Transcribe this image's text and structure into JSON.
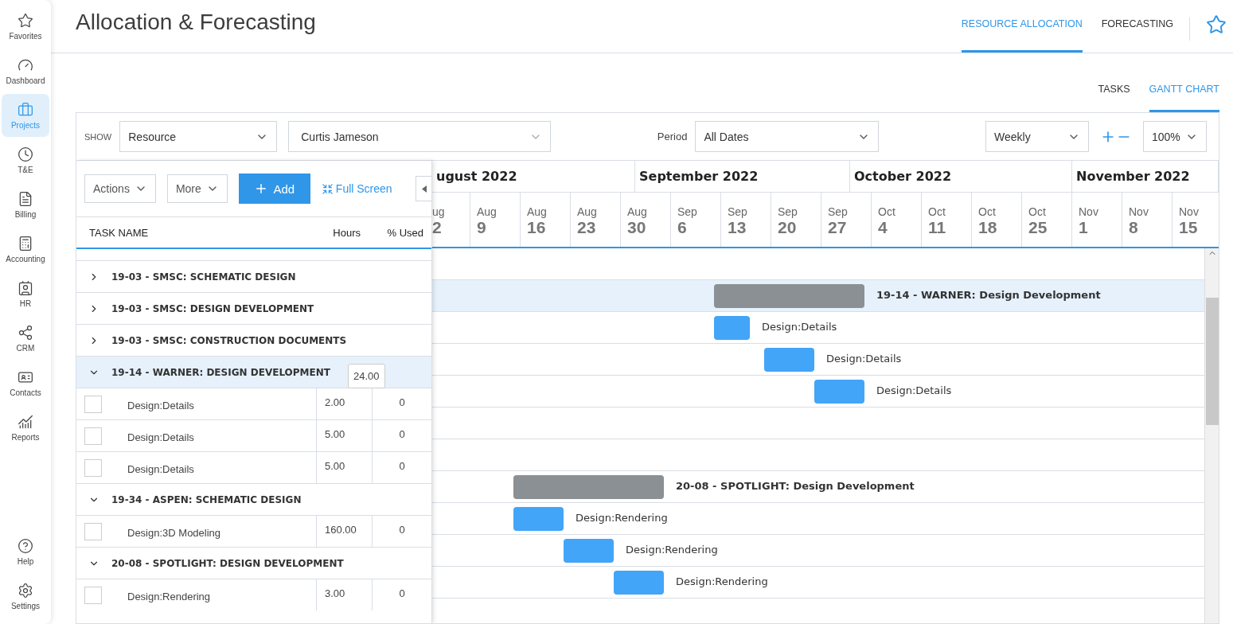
{
  "sidebar": {
    "items": [
      {
        "label": "Favorites",
        "selected": false
      },
      {
        "label": "Dashboard",
        "selected": false
      },
      {
        "label": "Projects",
        "selected": true
      },
      {
        "label": "T&E",
        "selected": false
      },
      {
        "label": "Billing",
        "selected": false
      },
      {
        "label": "Accounting",
        "selected": false
      },
      {
        "label": "HR",
        "selected": false
      },
      {
        "label": "CRM",
        "selected": false
      },
      {
        "label": "Contacts",
        "selected": false
      },
      {
        "label": "Reports",
        "selected": false
      }
    ],
    "bottom_items": [
      {
        "label": "Help",
        "selected": false
      },
      {
        "label": "Settings",
        "selected": false
      }
    ]
  },
  "header": {
    "title": "Allocation & Forecasting",
    "tabs": [
      {
        "label": "RESOURCE ALLOCATION",
        "selected": true
      },
      {
        "label": "FORECASTING",
        "selected": false
      }
    ]
  },
  "view_tabs": [
    {
      "label": "TASKS",
      "selected": false
    },
    {
      "label": "GANTT CHART",
      "selected": true
    }
  ],
  "filters": {
    "show_label": "SHOW",
    "show": "Resource",
    "resource": "Curtis Jameson",
    "period_label": "Period",
    "period": "All Dates",
    "scale": "Weekly",
    "zoom": "100%"
  },
  "task_panel": {
    "actions": "Actions",
    "more": "More",
    "add": "Add",
    "full_screen": "Full Screen",
    "columns": [
      "TASK NAME",
      "Hours",
      "% Used"
    ],
    "tooltip": "24.00",
    "rows": [
      {
        "kind": "group",
        "label": "19-03 - SMSC: SCHEMATIC DESIGN",
        "expanded": false,
        "selected": false
      },
      {
        "kind": "group",
        "label": "19-03 - SMSC: DESIGN DEVELOPMENT",
        "expanded": false,
        "selected": false
      },
      {
        "kind": "group",
        "label": "19-03 - SMSC: CONSTRUCTION DOCUMENTS",
        "expanded": false,
        "selected": false
      },
      {
        "kind": "group",
        "label": "19-14 - WARNER: DESIGN DEVELOPMENT",
        "expanded": true,
        "selected": true
      },
      {
        "kind": "task",
        "label": "Design:Details",
        "hours": "2.00",
        "used": "0",
        "checked": false
      },
      {
        "kind": "task",
        "label": "Design:Details",
        "hours": "5.00",
        "used": "0",
        "checked": false
      },
      {
        "kind": "task",
        "label": "Design:Details",
        "hours": "5.00",
        "used": "0",
        "checked": false
      },
      {
        "kind": "group",
        "label": "19-34 - ASPEN: SCHEMATIC DESIGN",
        "expanded": true,
        "selected": false
      },
      {
        "kind": "task",
        "label": "Design:3D Modeling",
        "hours": "160.00",
        "used": "0",
        "checked": false
      },
      {
        "kind": "group",
        "label": "20-08 - SPOTLIGHT: DESIGN DEVELOPMENT",
        "expanded": true,
        "selected": false
      },
      {
        "kind": "task",
        "label": "Design:Rendering",
        "hours": "3.00",
        "used": "0",
        "checked": false
      }
    ]
  },
  "timeline": {
    "months": [
      "ugust 2022",
      "September 2022",
      "October 2022",
      "November 2022"
    ],
    "weeks": [
      {
        "month": "ug",
        "day": "2"
      },
      {
        "month": "Aug",
        "day": "9"
      },
      {
        "month": "Aug",
        "day": "16"
      },
      {
        "month": "Aug",
        "day": "23"
      },
      {
        "month": "Aug",
        "day": "30"
      },
      {
        "month": "Sep",
        "day": "6"
      },
      {
        "month": "Sep",
        "day": "13"
      },
      {
        "month": "Sep",
        "day": "20"
      },
      {
        "month": "Sep",
        "day": "27"
      },
      {
        "month": "Oct",
        "day": "4"
      },
      {
        "month": "Oct",
        "day": "11"
      },
      {
        "month": "Oct",
        "day": "18"
      },
      {
        "month": "Oct",
        "day": "25"
      },
      {
        "month": "Nov",
        "day": "1"
      },
      {
        "month": "Nov",
        "day": "8"
      },
      {
        "month": "Nov",
        "day": "15"
      }
    ],
    "rows": [
      {
        "kind": "empty"
      },
      {
        "kind": "summary",
        "label": "19-14 - WARNER: Design Development",
        "selected": true
      },
      {
        "kind": "task",
        "label": "Design:Details",
        "selected": false
      },
      {
        "kind": "task",
        "label": "Design:Details",
        "selected": false
      },
      {
        "kind": "task",
        "label": "Design:Details",
        "selected": false
      },
      {
        "kind": "empty"
      },
      {
        "kind": "empty"
      },
      {
        "kind": "summary",
        "label": "20-08 - SPOTLIGHT: Design Development",
        "selected": false
      },
      {
        "kind": "task",
        "label": "Design:Rendering",
        "selected": false
      },
      {
        "kind": "task",
        "label": "Design:Rendering",
        "selected": false
      },
      {
        "kind": "task",
        "label": "Design:Rendering",
        "selected": false
      },
      {
        "kind": "empty"
      }
    ]
  }
}
